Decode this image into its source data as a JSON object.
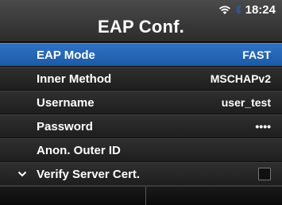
{
  "status_bar": {
    "time": "18:24",
    "icons": [
      "wifi-icon",
      "bluetooth-icon"
    ]
  },
  "header": {
    "title": "EAP Conf."
  },
  "menu": {
    "items": [
      {
        "label": "EAP Mode",
        "value": "FAST",
        "selected": true
      },
      {
        "label": "Inner Method",
        "value": "MSCHAPv2"
      },
      {
        "label": "Username",
        "value": "user_test"
      },
      {
        "label": "Password",
        "value": "••••"
      },
      {
        "label": "Anon. Outer ID",
        "value": ""
      },
      {
        "label": "Verify Server Cert.",
        "checked": false,
        "icon": "chevron-down-icon"
      }
    ]
  },
  "colors": {
    "selected_row": "#2a6bbf",
    "header_bg": "#3a3a3a",
    "row_bg": "#262626"
  }
}
